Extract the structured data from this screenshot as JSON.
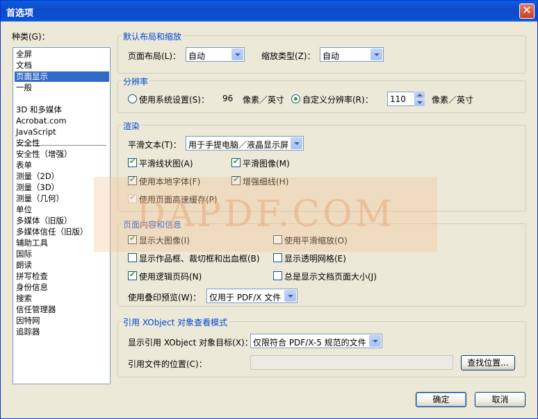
{
  "window": {
    "title": "首选项",
    "close_glyph": "✕"
  },
  "categories": {
    "label": "种类(G)：",
    "items": [
      "全屏",
      "文档",
      "页面显示",
      "一般",
      "3D 和多媒体",
      "Acrobat.com",
      "JavaScript",
      "安全性",
      "安全性（增强）",
      "表单",
      "测量（2D）",
      "测量（3D）",
      "测量（几何）",
      "单位",
      "多媒体（旧版）",
      "多媒体信任（旧版）",
      "辅助工具",
      "国际",
      "朗读",
      "拼写检查",
      "身份信息",
      "搜索",
      "信任管理器",
      "因特网",
      "追踪器"
    ],
    "selected_index": 2
  },
  "layout_zoom": {
    "title": "默认布局和缩放",
    "page_layout_label": "页面布局(L)：",
    "page_layout_value": "自动",
    "zoom_type_label": "缩放类型(Z)：",
    "zoom_type_value": "自动"
  },
  "resolution": {
    "title": "分辨率",
    "system_label": "使用系统设置(S)：",
    "system_value": "96",
    "system_unit": "像素／英寸",
    "custom_label": "自定义分辨率(R)：",
    "custom_value": "110",
    "custom_unit": "像素／英寸",
    "selected": "custom"
  },
  "rendering": {
    "title": "渲染",
    "smooth_text_label": "平滑文本(T)：",
    "smooth_text_value": "用于手提电脑／液晶显示屏",
    "smooth_line_art": {
      "label": "平滑线状图(A)",
      "checked": true
    },
    "smooth_images": {
      "label": "平滑图像(M)",
      "checked": true
    },
    "use_local_fonts": {
      "label": "使用本地字体(F)",
      "checked": true
    },
    "enhance_thin_lines": {
      "label": "增强细线(H)",
      "checked": true
    },
    "use_page_cache": {
      "label": "使用页面高速缓存(P)",
      "checked": true
    }
  },
  "page_content": {
    "title": "页面内容和信息",
    "show_large_images": {
      "label": "显示大图像(I)",
      "checked": true
    },
    "use_smooth_zoom": {
      "label": "使用平滑缩放(O)",
      "checked": false
    },
    "show_art_trim_bleed": {
      "label": "显示作品框、裁切框和出血框(B)",
      "checked": false
    },
    "show_transparency_grid": {
      "label": "显示透明网格(E)",
      "checked": false
    },
    "use_logical_page_numbers": {
      "label": "使用逻辑页码(N)",
      "checked": true
    },
    "always_show_doc_page_size": {
      "label": "总是显示文档页面大小(J)",
      "checked": false
    },
    "overprint_preview_label": "使用叠印预览(W)：",
    "overprint_preview_value": "仅用于 PDF/X 文件"
  },
  "xobject": {
    "title": "引用 XObject 对象查看模式",
    "show_targets_label": "显示引用 XObject 对象目标(X)：",
    "show_targets_value": "仅限符合 PDF/X-5 规范的文件",
    "file_location_label": "引用文件的位置(C)：",
    "file_location_value": "",
    "browse_label": "查找位置..."
  },
  "buttons": {
    "ok": "确定",
    "cancel": "取消"
  },
  "watermark": {
    "text": "DAPDF.COM"
  }
}
